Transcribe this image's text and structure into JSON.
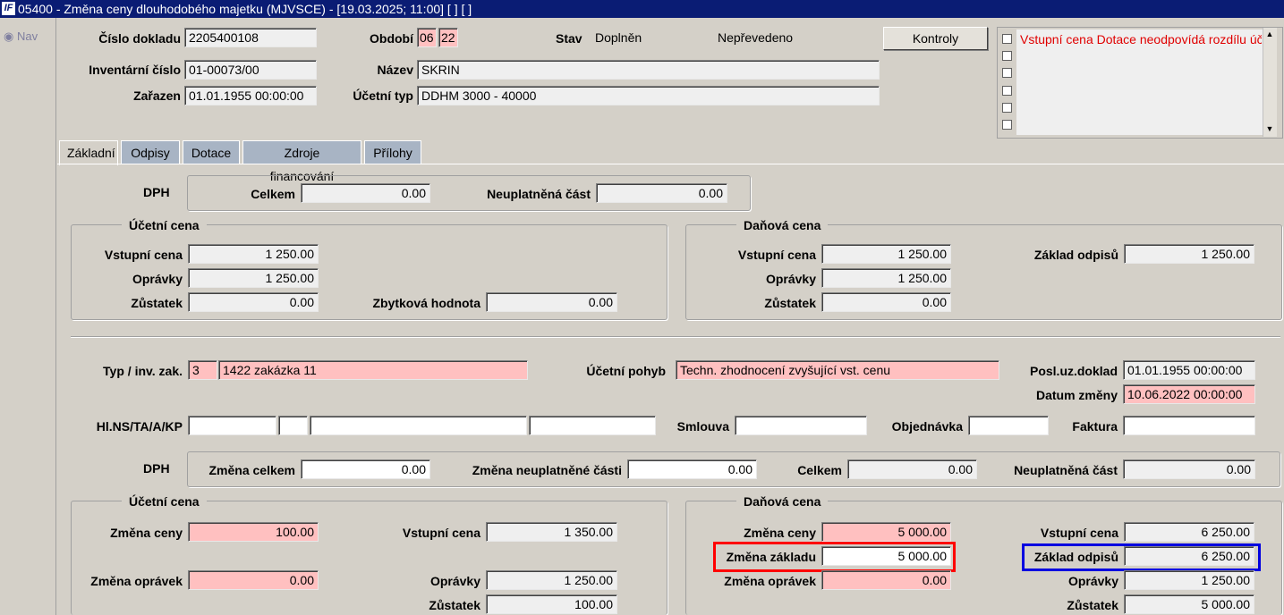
{
  "window": {
    "title": "05400 - Změna ceny dlouhodobého majetku (MJVSCE) - [19.03.2025; 11:00]  [ ]  [ ]",
    "icon": "app-logo-icon"
  },
  "nav": {
    "label": "Nav"
  },
  "header": {
    "cislo_dokladu_label": "Číslo dokladu",
    "cislo_dokladu": "2205400108",
    "obdobi_label": "Období",
    "obdobi_month": "06",
    "obdobi_year": "22",
    "stav_label": "Stav",
    "stav_value": "Doplněn",
    "stav_value2": "Nepřevedeno",
    "kontroly_button": "Kontroly",
    "inventarni_cislo_label": "Inventární číslo",
    "inventarni_cislo": "01-00073/00",
    "nazev_label": "Název",
    "nazev": "SKRIN",
    "zarazen_label": "Zařazen",
    "zarazen": "01.01.1955 00:00:00",
    "ucetni_typ_label": "Účetní typ",
    "ucetni_typ": "DDHM 3000 - 40000"
  },
  "messages": {
    "items": [
      "Vstupní cena Dotace neodpovídá rozdílu úč",
      "",
      "",
      "",
      "",
      ""
    ]
  },
  "tabs": [
    {
      "label": "Základní",
      "active": true
    },
    {
      "label": "Odpisy"
    },
    {
      "label": "Dotace"
    },
    {
      "label": "Zdroje financování"
    },
    {
      "label": "Přílohy"
    }
  ],
  "dph_top": {
    "label": "DPH",
    "celkem_label": "Celkem",
    "celkem": "0.00",
    "neuplatnena_label": "Neuplatněná část",
    "neuplatnena": "0.00"
  },
  "ucetni_cena_top": {
    "title": "Účetní cena",
    "vstupni_label": "Vstupní cena",
    "vstupni": "1 250.00",
    "opravky_label": "Oprávky",
    "opravky": "1 250.00",
    "zustatek_label": "Zůstatek",
    "zustatek": "0.00",
    "zbytkova_label": "Zbytková hodnota",
    "zbytkova": "0.00"
  },
  "danova_cena_top": {
    "title": "Daňová cena",
    "vstupni_label": "Vstupní cena",
    "vstupni": "1 250.00",
    "opravky_label": "Oprávky",
    "opravky": "1 250.00",
    "zustatek_label": "Zůstatek",
    "zustatek": "0.00",
    "zaklad_label": "Základ odpisů",
    "zaklad": "1 250.00"
  },
  "movement": {
    "typ_label": "Typ / inv. zak.",
    "typ": "3",
    "zakazka": "1422 zakázka 11",
    "pohyb_label": "Účetní pohyb",
    "pohyb": "Techn. zhodnocení zvyšující vst. cenu",
    "posl_label": "Posl.uz.doklad",
    "posl": "01.01.1955 00:00:00",
    "datum_label": "Datum změny",
    "datum": "10.06.2022 00:00:00",
    "hlns_label": "Hl.NS/TA/A/KP",
    "smlouva_label": "Smlouva",
    "objednavka_label": "Objednávka",
    "faktura_label": "Faktura"
  },
  "dph_bottom": {
    "label": "DPH",
    "zmena_celkem_label": "Změna celkem",
    "zmena_celkem": "0.00",
    "zmena_neupl_label": "Změna neuplatněné části",
    "zmena_neupl": "0.00",
    "celkem_label": "Celkem",
    "celkem": "0.00",
    "neuplatnena_label": "Neuplatněná část",
    "neuplatnena": "0.00"
  },
  "ucetni_cena_bottom": {
    "title": "Účetní cena",
    "zmena_ceny_label": "Změna ceny",
    "zmena_ceny": "100.00",
    "vstupni_label": "Vstupní cena",
    "vstupni": "1 350.00",
    "zmena_opravek_label": "Změna oprávek",
    "zmena_opravek": "0.00",
    "opravky_label": "Oprávky",
    "opravky": "1 250.00",
    "zustatek_label": "Zůstatek",
    "zustatek": "100.00"
  },
  "danova_cena_bottom": {
    "title": "Daňová cena",
    "zmena_ceny_label": "Změna ceny",
    "zmena_ceny": "5 000.00",
    "zmena_zakladu_label": "Změna základu",
    "zmena_zakladu": "5 000.00",
    "zmena_opravek_label": "Změna oprávek",
    "zmena_opravek": "0.00",
    "vstupni_label": "Vstupní cena",
    "vstupni": "6 250.00",
    "zaklad_label": "Základ odpisů",
    "zaklad": "6 250.00",
    "opravky_label": "Oprávky",
    "opravky": "1 250.00",
    "zustatek_label": "Zůstatek",
    "zustatek": "5 000.00"
  },
  "colors": {
    "required": "#ffc0c0",
    "highlight_red": "#ff0000",
    "highlight_blue": "#0000e0",
    "titlebar": "#0a1c74"
  }
}
